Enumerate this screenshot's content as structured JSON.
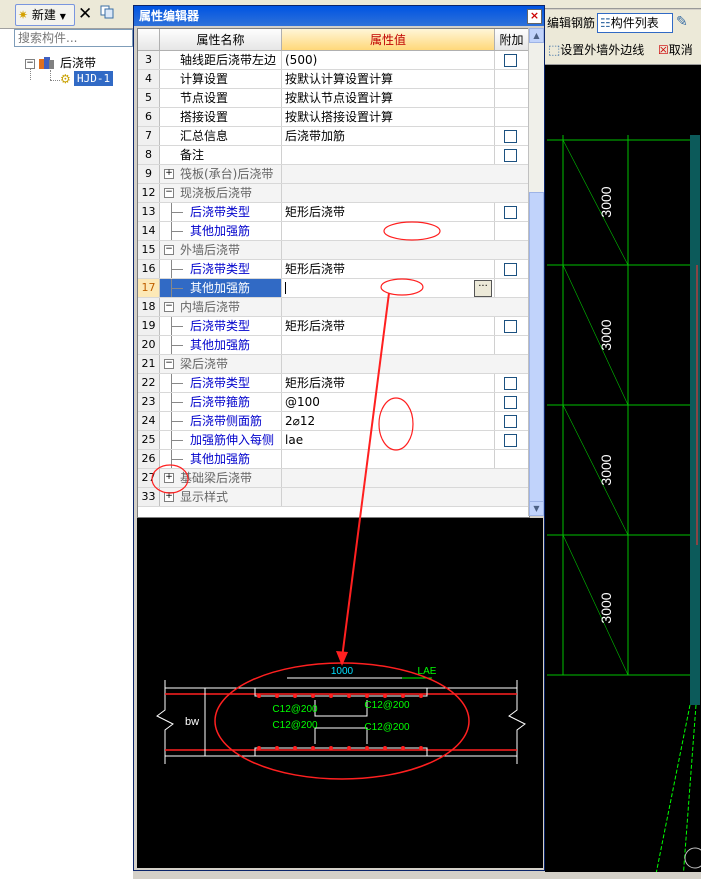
{
  "left_panel": {
    "new_label": "新建",
    "search_placeholder": "搜索构件...",
    "tree_root": "后浇带",
    "tree_child": "HJD-1"
  },
  "right_toolbar": {
    "edit_rebar": "编辑钢筋",
    "component_list": "构件列表",
    "set_outer_wall_edge": "设置外墙外边线",
    "cancel": "取消"
  },
  "cad_dimensions": [
    "3000",
    "3000",
    "3000",
    "3000"
  ],
  "dialog": {
    "title": "属性编辑器",
    "close": "×",
    "columns": {
      "name": "属性名称",
      "value": "属性值",
      "extra": "附加"
    },
    "rows": [
      {
        "num": "3",
        "name": "轴线距后浇带左边",
        "value": "(500)",
        "checkbox": true
      },
      {
        "num": "4",
        "name": "计算设置",
        "value": "按默认计算设置计算"
      },
      {
        "num": "5",
        "name": "节点设置",
        "value": "按默认节点设置计算"
      },
      {
        "num": "6",
        "name": "搭接设置",
        "value": "按默认搭接设置计算"
      },
      {
        "num": "7",
        "name": "汇总信息",
        "value": "后浇带加筋",
        "checkbox": true
      },
      {
        "num": "8",
        "name": "备注",
        "value": "",
        "checkbox": true
      },
      {
        "num": "9",
        "name": "筏板(承台)后浇带",
        "group": true,
        "toggle": "+"
      },
      {
        "num": "12",
        "name": "现浇板后浇带",
        "group": true,
        "toggle": "−"
      },
      {
        "num": "13",
        "name": "后浇带类型",
        "value": "矩形后浇带",
        "checkbox": true,
        "child": true,
        "blue": true
      },
      {
        "num": "14",
        "name": "其他加强筋",
        "value": "",
        "child": true,
        "blue": true
      },
      {
        "num": "15",
        "name": "外墙后浇带",
        "group": true,
        "toggle": "−"
      },
      {
        "num": "16",
        "name": "后浇带类型",
        "value": "矩形后浇带",
        "checkbox": true,
        "child": true,
        "blue": true
      },
      {
        "num": "17",
        "name": "其他加强筋",
        "value": "",
        "child": true,
        "selected": true,
        "ellipsis": "···"
      },
      {
        "num": "18",
        "name": "内墙后浇带",
        "group": true,
        "toggle": "−"
      },
      {
        "num": "19",
        "name": "后浇带类型",
        "value": "矩形后浇带",
        "checkbox": true,
        "child": true,
        "blue": true
      },
      {
        "num": "20",
        "name": "其他加强筋",
        "value": "",
        "child": true,
        "blue": true
      },
      {
        "num": "21",
        "name": "梁后浇带",
        "group": true,
        "toggle": "−"
      },
      {
        "num": "22",
        "name": "后浇带类型",
        "value": "矩形后浇带",
        "checkbox": true,
        "child": true,
        "blue": true
      },
      {
        "num": "23",
        "name": "后浇带箍筋",
        "value": "@100",
        "checkbox": true,
        "child": true,
        "blue": true
      },
      {
        "num": "24",
        "name": "后浇带侧面筋",
        "value": "2⌀12",
        "checkbox": true,
        "child": true,
        "blue": true
      },
      {
        "num": "25",
        "name": "加强筋伸入每侧",
        "value": "lae",
        "checkbox": true,
        "child": true,
        "blue": true
      },
      {
        "num": "26",
        "name": "其他加强筋",
        "value": "",
        "child": true,
        "blue": true
      },
      {
        "num": "27",
        "name": "基础梁后浇带",
        "group": true,
        "toggle": "+"
      },
      {
        "num": "33",
        "name": "显示样式",
        "group": true,
        "toggle": "+"
      }
    ]
  },
  "preview": {
    "dim_width": "1000",
    "dim_lae": "LAE",
    "label_bw": "bw",
    "rebar_labels": [
      "C12@200",
      "C12@200",
      "C12@200",
      "C12@200"
    ]
  },
  "colors": {
    "title_bar": "#0054e3",
    "annotation_red": "#ff2020",
    "cad_green": "#00c000",
    "preview_green": "#00ff00",
    "preview_cyan": "#00e0ff"
  }
}
